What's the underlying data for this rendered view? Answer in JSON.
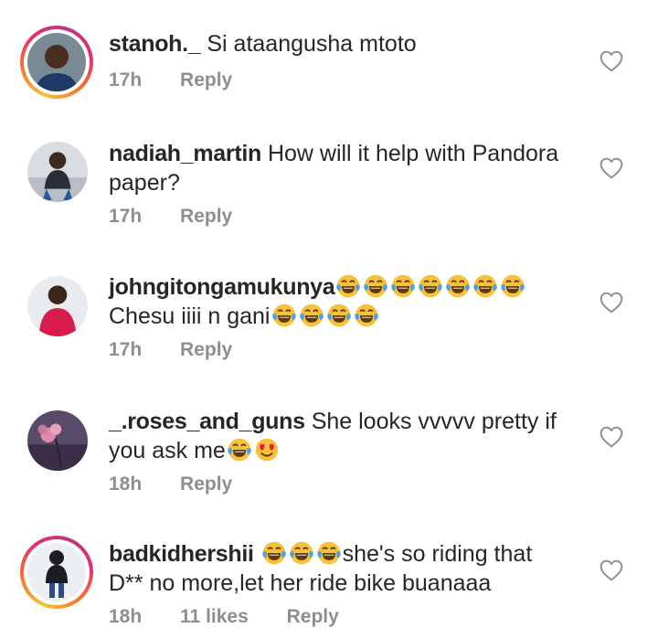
{
  "comments": [
    {
      "username": "stanoh._",
      "text": "Si ataangusha mtoto",
      "time": "17h",
      "reply": "Reply",
      "story_ring": true
    },
    {
      "username": "nadiah_martin",
      "text": "How will it help with Pandora",
      "text2": "paper?",
      "time": "17h",
      "reply": "Reply",
      "story_ring": false
    },
    {
      "username": "johngitongamukunya",
      "text2": "Chesu iiii n gani",
      "time": "17h",
      "reply": "Reply",
      "story_ring": false,
      "emoji_after_username": [
        "tears-of-joy",
        "tears-of-joy",
        "tears-of-joy",
        "tears-of-joy",
        "tears-of-joy",
        "tears-of-joy",
        "tears-of-joy"
      ],
      "emoji_line2": [
        "tears-of-joy",
        "tears-of-joy",
        "tears-of-joy",
        "tears-of-joy"
      ]
    },
    {
      "username": "_.roses_and_guns",
      "text": "She looks vvvvv pretty if",
      "text2": "you ask me",
      "time": "18h",
      "reply": "Reply",
      "story_ring": false,
      "emoji_line2": [
        "tears-of-joy",
        "heart-eyes"
      ]
    },
    {
      "username": "badkidhershii",
      "text": "she's so riding that",
      "text2": "D** no more,let her ride bike buanaaa",
      "time": "18h",
      "likes": "11 likes",
      "reply": "Reply",
      "story_ring": true,
      "emoji_after_username": [
        "tears-of-joy",
        "tears-of-joy",
        "tears-of-joy"
      ]
    }
  ],
  "colors": {
    "text": "#262626",
    "meta": "#8e8e8e",
    "emoji_face": "#f7c13a"
  }
}
